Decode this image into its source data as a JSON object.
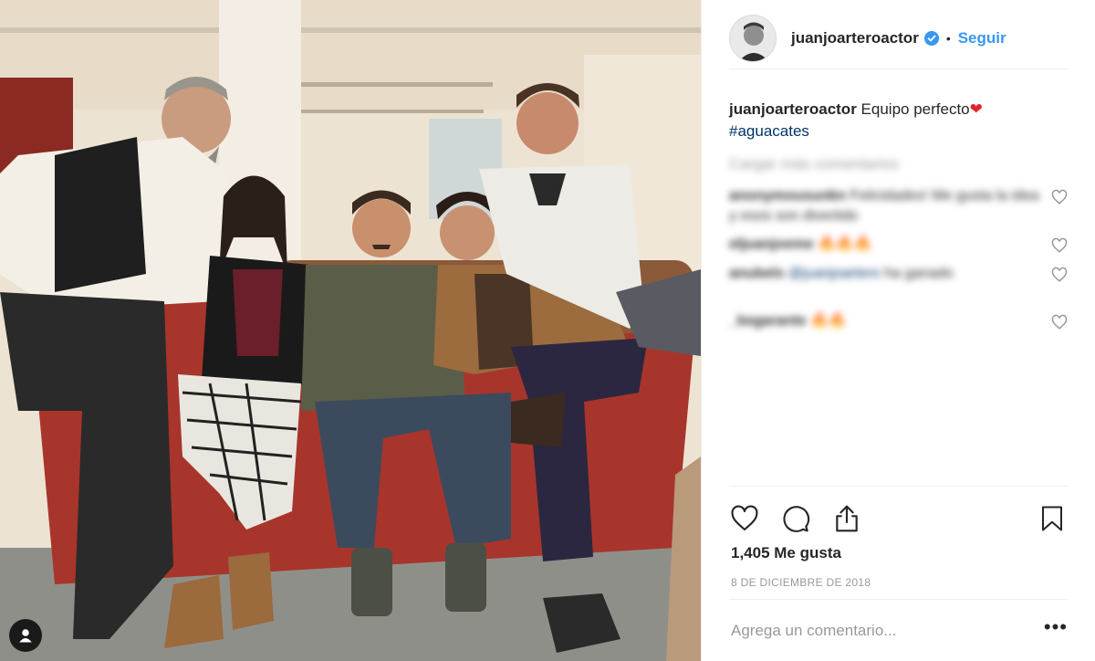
{
  "post": {
    "username": "juanjoarteroactor",
    "follow_label": "Seguir",
    "dot": "•",
    "caption_text": "Equipo perfecto",
    "caption_emoji": "❤",
    "hashtag": "#aguacates",
    "load_more": "Cargar más comentarios",
    "comments": [
      {
        "user": "anonymousunkn",
        "text": "Felicidades! Me gusta la idea y esos son divertido",
        "mention": ""
      },
      {
        "user": "eljuanjoeme",
        "text": "🔥🔥🔥",
        "mention": ""
      },
      {
        "user": "anubels",
        "text": "ha ganado",
        "mention": "@juanjoartero"
      },
      {
        "user": "_kegarante",
        "text": "🔥🔥",
        "mention": ""
      }
    ],
    "likes": "1,405 Me gusta",
    "date": "8 DE DICIEMBRE DE 2018",
    "comment_placeholder": "Agrega un comentario...",
    "more_label": "•••"
  },
  "icons": {
    "verified": "verified-badge-icon",
    "like": "heart-icon",
    "comment": "comment-bubble-icon",
    "share": "share-icon",
    "save": "bookmark-icon",
    "user_tag": "user-tag-icon"
  },
  "colors": {
    "link": "#3897f0",
    "hashtag": "#003569",
    "heart": "#e0242d",
    "muted": "#999999"
  }
}
